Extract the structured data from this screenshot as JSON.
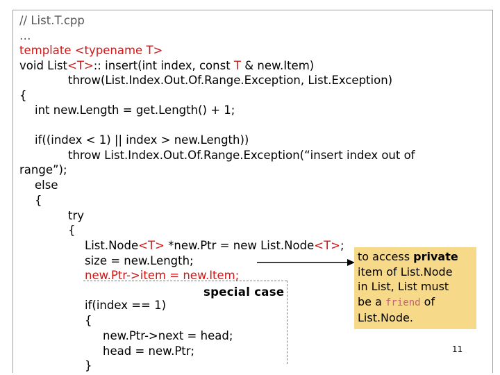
{
  "slide": {
    "page_number": "11",
    "code": {
      "l1": "// List.T.cpp",
      "l2": "…",
      "l3": "template <typename T>",
      "l4_pre": "void List",
      "l4_t": "<T>",
      "l4_mid": ":: insert(int index, const ",
      "l4_T": "T",
      "l4_post": " & new.Item)",
      "l5": "throw(List.Index.Out.Of.Range.Exception, List.Exception)",
      "l6": "{",
      "l7": "int new.Length = get.Length() + 1;",
      "l8": "if((index < 1) || index > new.Length))",
      "l9": "throw List.Index.Out.Of.Range.Exception(“insert index out of",
      "l10": "range”);",
      "l11": "else",
      "l12": "{",
      "l13": "try",
      "l14": "{",
      "l15_pre": "List.Node",
      "l15_t": "<T>",
      "l15_mid": " *new.Ptr = new List.Node",
      "l15_t2": "<T>",
      "l15_post": ";",
      "l16": "size = new.Length;",
      "l17": "new.Ptr->item = new.Item;",
      "l18": "if(index == 1)",
      "l19": "{",
      "l20": "new.Ptr->next = head;",
      "l21": "head = new.Ptr;",
      "l22": "}"
    },
    "special_case_label": "special case",
    "callout": {
      "line1_pre": "to access ",
      "line1_bold": "private",
      "line2": "item of List.Node",
      "line3": "in List, List must",
      "line4_pre": "be a ",
      "line4_mono": "friend",
      "line4_post": " of",
      "line5": "List.Node."
    }
  }
}
